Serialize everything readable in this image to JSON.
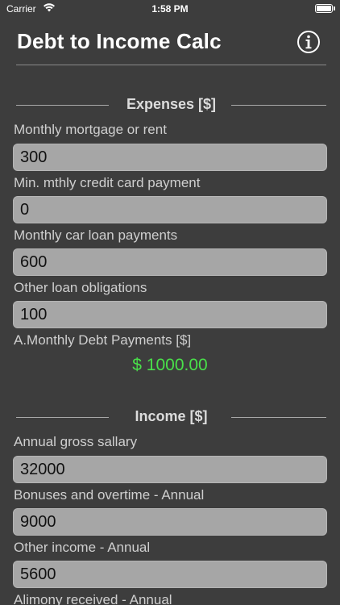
{
  "status_bar": {
    "carrier": "Carrier",
    "time": "1:58 PM",
    "wifi_icon": "wifi-icon",
    "battery_icon": "battery-icon"
  },
  "header": {
    "title": "Debt to Income Calc",
    "info_icon": "info-icon"
  },
  "expenses": {
    "heading": "Expenses [$]",
    "fields": [
      {
        "label": "Monthly mortgage or rent",
        "value": "300"
      },
      {
        "label": "Min. mthly credit card payment",
        "value": "0"
      },
      {
        "label": "Monthly car loan payments",
        "value": "600"
      },
      {
        "label": "Other loan obligations",
        "value": "100"
      }
    ],
    "total_label": "A.Monthly Debt Payments [$]",
    "total_value": "$ 1000.00"
  },
  "income": {
    "heading": "Income [$]",
    "fields": [
      {
        "label": "Annual gross sallary",
        "value": "32000"
      },
      {
        "label": "Bonuses and overtime - Annual",
        "value": "9000"
      },
      {
        "label": "Other income - Annual",
        "value": "5600"
      },
      {
        "label": "Alimony received - Annual",
        "value": ""
      }
    ]
  },
  "colors": {
    "background": "#3d3d3d",
    "input_background": "#a6a6a6",
    "result_green": "#49e04a"
  }
}
